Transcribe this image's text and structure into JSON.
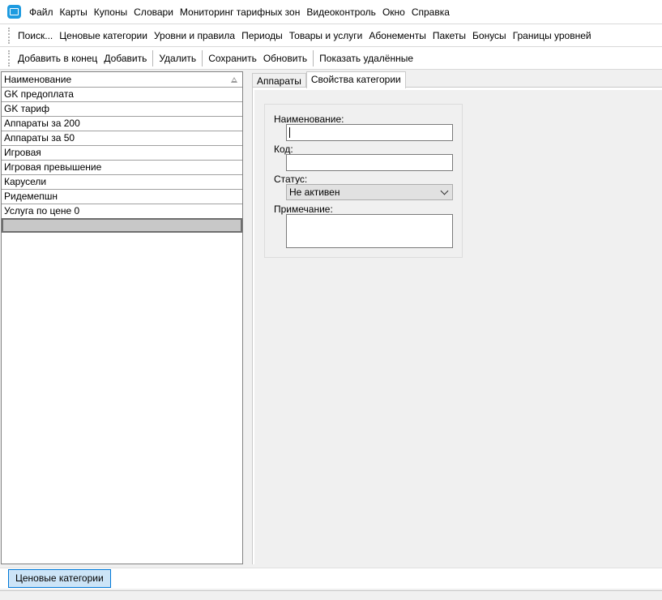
{
  "menu": {
    "items": [
      "Файл",
      "Карты",
      "Купоны",
      "Словари",
      "Мониторинг тарифных зон",
      "Видеоконтроль",
      "Окно",
      "Справка"
    ]
  },
  "nav_toolbar": {
    "items": [
      "Поиск...",
      "Ценовые категории",
      "Уровни и правила",
      "Периоды",
      "Товары и услуги",
      "Абонементы",
      "Пакеты",
      "Бонусы",
      "Границы уровней"
    ]
  },
  "action_toolbar": {
    "add_to_end": "Добавить в конец",
    "add": "Добавить",
    "delete": "Удалить",
    "save": "Сохранить",
    "refresh": "Обновить",
    "show_deleted": "Показать удалённые"
  },
  "list": {
    "header": "Наименование",
    "rows": [
      "GK  предоплата",
      "GK тариф",
      "Аппараты за 200",
      "Аппараты за 50",
      "Игровая",
      "Игровая превышение",
      "Карусели",
      "Ридемепшн",
      "Услуга по цене 0",
      ""
    ]
  },
  "tabs": {
    "devices": "Аппараты",
    "category_props": "Свойства категории"
  },
  "form": {
    "name_label": "Наименование:",
    "name_value": "",
    "code_label": "Код:",
    "code_value": "",
    "status_label": "Статус:",
    "status_value": "Не активен",
    "note_label": "Примечание:",
    "note_value": ""
  },
  "taskbar": {
    "window_label": "Ценовые категории"
  }
}
